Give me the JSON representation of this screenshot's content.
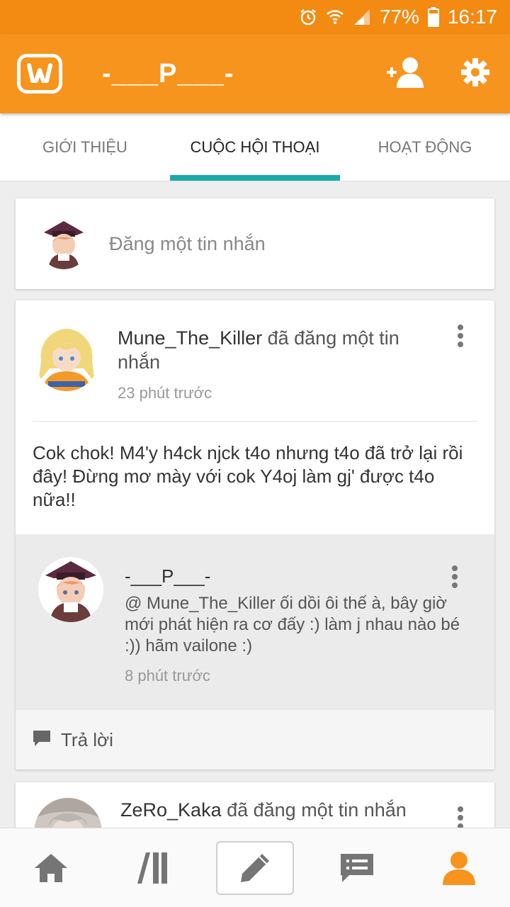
{
  "status_bar": {
    "battery": "77%",
    "time": "16:17",
    "icons": [
      "alarm-icon",
      "wifi-icon",
      "signal-icon",
      "battery-icon"
    ]
  },
  "header": {
    "title": "-___P___-",
    "logo_icon": "wattpad-logo-icon",
    "actions": [
      "add-follower-icon",
      "gear-icon"
    ]
  },
  "tabs": [
    {
      "label": "GIỚI THIỆU",
      "active": false
    },
    {
      "label": "CUỘC HỘI THOẠI",
      "active": true
    },
    {
      "label": "HOẠT ĐỘNG",
      "active": false
    }
  ],
  "compose": {
    "placeholder": "Đăng một tin nhắn"
  },
  "posts": [
    {
      "author": "Mune_The_Killer",
      "action": " đã đăng một tin nhắn",
      "time": "23 phút trước",
      "body": "Cok chok! M4'y h4ck njck t4o nhưng t4o đã trở lại rồi đây! Đừng mơ mày với cok Y4oj làm gj' được t4o nữa!!",
      "reply": {
        "author": "-___P___-",
        "text": "@ Mune_The_Killer  ối dồi ôi thế à, bây giờ mới phát hiện ra cơ đấy :) làm j nhau nào bé :)) hãm vailone :)",
        "time": "8 phút trước"
      },
      "reply_label": "Trả lời"
    },
    {
      "author": "ZeRo_Kaka",
      "action": " đã đăng một tin nhắn"
    }
  ],
  "bottom_nav": [
    "home-icon",
    "library-icon",
    "write-icon",
    "messages-icon",
    "profile-icon"
  ],
  "colors": {
    "accent_orange": "#f7941d",
    "status_orange": "#f38a12",
    "tab_indicator": "#1ca9a8"
  }
}
